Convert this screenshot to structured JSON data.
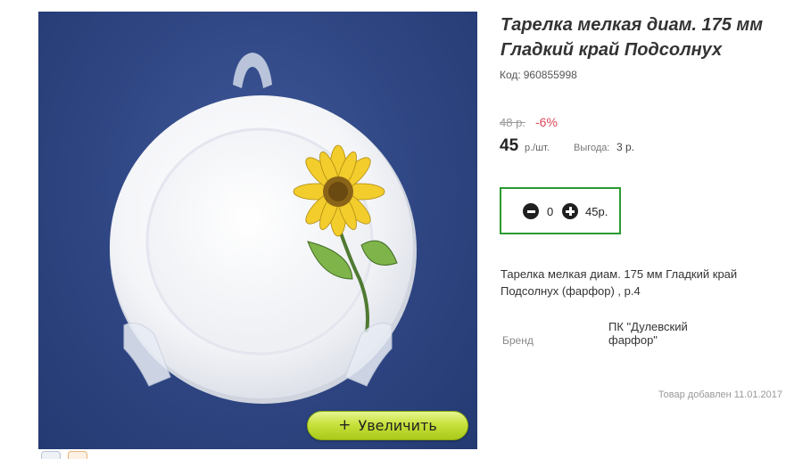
{
  "product": {
    "title": "Тарелка мелкая диам. 175 мм Гладкий край Подсолнух",
    "code_label": "Код:",
    "code_value": "960855998",
    "image_alt": "Тарелка с подсолнухом на подставке"
  },
  "pricing": {
    "old_price": "48 р.",
    "discount": "-6%",
    "price": "45",
    "unit": "р./шт.",
    "benefit_label": "Выгода:",
    "benefit_value": "3 р."
  },
  "cart": {
    "quantity": "0",
    "total": "45р.",
    "minus_icon": "minus-circle-icon",
    "plus_icon": "plus-circle-icon"
  },
  "zoom_button": {
    "icon": "+",
    "label": "Увеличить"
  },
  "description": "Тарелка мелкая диам. 175 мм Гладкий край Подсолнух (фарфор) , р.4",
  "brand": {
    "label": "Бренд",
    "value": "ПК \"Дулевский фарфор\""
  },
  "added_date": "Товар добавлен 11.01.2017",
  "social": [
    "vk-icon",
    "odnoklassniki-icon"
  ],
  "colors": {
    "accent_green": "#2b9a2f",
    "discount_red": "#e0445a",
    "button_lime": "#c8e23c",
    "photo_bg": "#2e4582"
  }
}
